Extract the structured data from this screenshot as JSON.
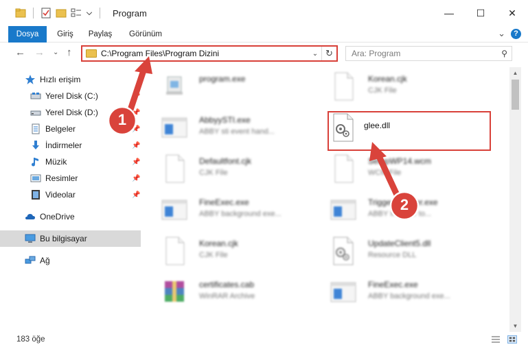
{
  "window": {
    "title": "Program",
    "minimize": "—",
    "maximize": "☐",
    "close": "✕"
  },
  "ribbon": {
    "tabs": [
      "Dosya",
      "Giriş",
      "Paylaş",
      "Görünüm"
    ],
    "expand": "⌄",
    "help": "?"
  },
  "nav": {
    "back": "←",
    "forward": "→",
    "recent": "⌄",
    "up": "↑",
    "address": "C:\\Program Files\\Program Dizini",
    "address_dropdown": "⌄",
    "refresh": "↻",
    "search_placeholder": "Ara: Program",
    "search_icon": "⚲"
  },
  "sidebar": {
    "items": [
      {
        "label": "Hızlı erişim",
        "icon": "star-icon",
        "pinned": false
      },
      {
        "label": "Yerel Disk (C:)",
        "icon": "drive-icon",
        "pinned": true
      },
      {
        "label": "Yerel Disk (D:)",
        "icon": "drive-icon",
        "pinned": true
      },
      {
        "label": "Belgeler",
        "icon": "documents-icon",
        "pinned": true
      },
      {
        "label": "İndirmeler",
        "icon": "download-icon",
        "pinned": true
      },
      {
        "label": "Müzik",
        "icon": "music-icon",
        "pinned": true
      },
      {
        "label": "Resimler",
        "icon": "pictures-icon",
        "pinned": true
      },
      {
        "label": "Videolar",
        "icon": "videos-icon",
        "pinned": true
      },
      {
        "label": "OneDrive",
        "icon": "onedrive-icon",
        "pinned": false
      },
      {
        "label": "Bu bilgisayar",
        "icon": "computer-icon",
        "pinned": false,
        "selected": true
      },
      {
        "label": "Ağ",
        "icon": "network-icon",
        "pinned": false
      }
    ],
    "pin_glyph": "📌"
  },
  "files": [
    {
      "name": "program.exe",
      "type": "",
      "icon": "installer-icon",
      "focus": false
    },
    {
      "name": "Korean.cjk",
      "type": "CJK File",
      "icon": "blank-file-icon",
      "focus": false
    },
    {
      "name": "AbbyySTI.exe",
      "type": "ABBY sti event hand...",
      "icon": "app-window-icon",
      "focus": false
    },
    {
      "name": "glee.dll",
      "type": "",
      "icon": "dll-gear-icon",
      "focus": true
    },
    {
      "name": "Defaultfont.cjk",
      "type": "CJK File",
      "icon": "blank-file-icon",
      "focus": false
    },
    {
      "name": "SetupWP14.wcm",
      "type": "WCM File",
      "icon": "blank-file-icon",
      "focus": false
    },
    {
      "name": "FineExec.exe",
      "type": "ABBY background exe...",
      "icon": "app-window-icon",
      "focus": false
    },
    {
      "name": "TriggerInstaller.exe",
      "type": "ABBY Installer to...",
      "icon": "app-window-icon",
      "focus": false
    },
    {
      "name": "Korean.cjk",
      "type": "CJK File",
      "icon": "blank-file-icon",
      "focus": false
    },
    {
      "name": "UpdateClient5.dll",
      "type": "Resource DLL",
      "icon": "dll-gear-icon",
      "focus": false
    },
    {
      "name": "certificates.cab",
      "type": "WinRAR Archive",
      "icon": "winrar-icon",
      "focus": false
    },
    {
      "name": "FineExec.exe",
      "type": "ABBY background exe...",
      "icon": "app-window-icon",
      "focus": false
    }
  ],
  "callouts": [
    {
      "number": "1"
    },
    {
      "number": "2"
    }
  ],
  "status": {
    "count": "183 öğe"
  },
  "colors": {
    "accent": "#1979ca",
    "highlight_red": "#d83f38",
    "callout_red": "#d9433b",
    "folder_yellow": "#ebc14f"
  }
}
